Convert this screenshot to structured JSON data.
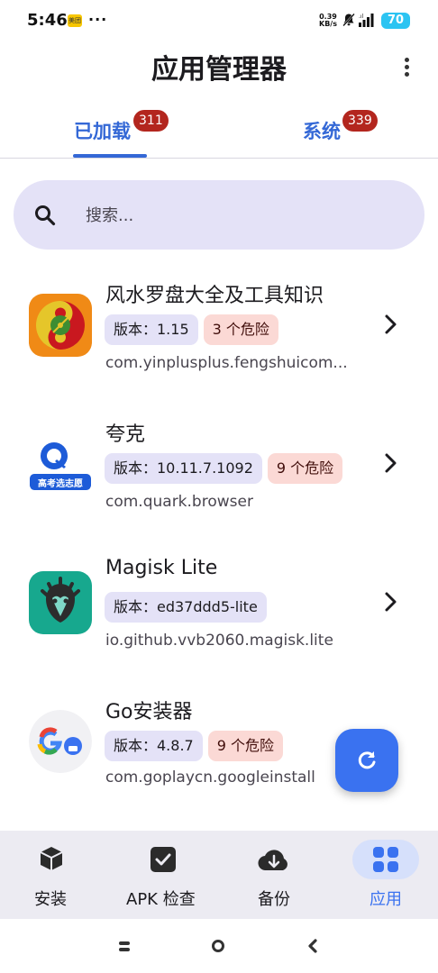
{
  "status_bar": {
    "time": "5:46",
    "app_badge": "美团",
    "more": "···",
    "net_speed_value": "0.39",
    "net_speed_unit": "KB/s",
    "battery": "70"
  },
  "header": {
    "title": "应用管理器",
    "menu_icon": "more-vert-icon"
  },
  "tabs": [
    {
      "label": "已加载",
      "badge": "311",
      "selected": true
    },
    {
      "label": "系统",
      "badge": "339",
      "selected": false
    }
  ],
  "search": {
    "placeholder": "搜索..."
  },
  "apps": [
    {
      "name": "风水罗盘大全及工具知识",
      "version": "版本：1.15",
      "danger": "3 个危险",
      "package": "com.yinplusplus.fengshuicom..."
    },
    {
      "name": "夸克",
      "icon_label": "高考选志愿",
      "version": "版本：10.11.7.1092",
      "danger": "9 个危险",
      "package": "com.quark.browser"
    },
    {
      "name": "Magisk Lite",
      "version": "版本：ed37ddd5-lite",
      "package": "io.github.vvb2060.magisk.lite"
    },
    {
      "name": "Go安装器",
      "version": "版本：4.8.7",
      "danger": "9 个危险",
      "package": "com.goplaycn.googleinstall"
    }
  ],
  "fab": {
    "icon": "refresh-icon"
  },
  "bottom_nav": [
    {
      "label": "安装",
      "icon": "package-icon",
      "active": false
    },
    {
      "label": "APK 检查",
      "icon": "check-box-icon",
      "active": false
    },
    {
      "label": "备份",
      "icon": "cloud-download-icon",
      "active": false
    },
    {
      "label": "应用",
      "icon": "grid-apps-icon",
      "active": true
    }
  ],
  "colors": {
    "accent": "#3468d6",
    "badge": "#b3261e",
    "chip_version": "#e4e2f7",
    "chip_danger": "#fbd9d5",
    "fab": "#3a72f0",
    "nav_bg": "#ecebf2"
  }
}
